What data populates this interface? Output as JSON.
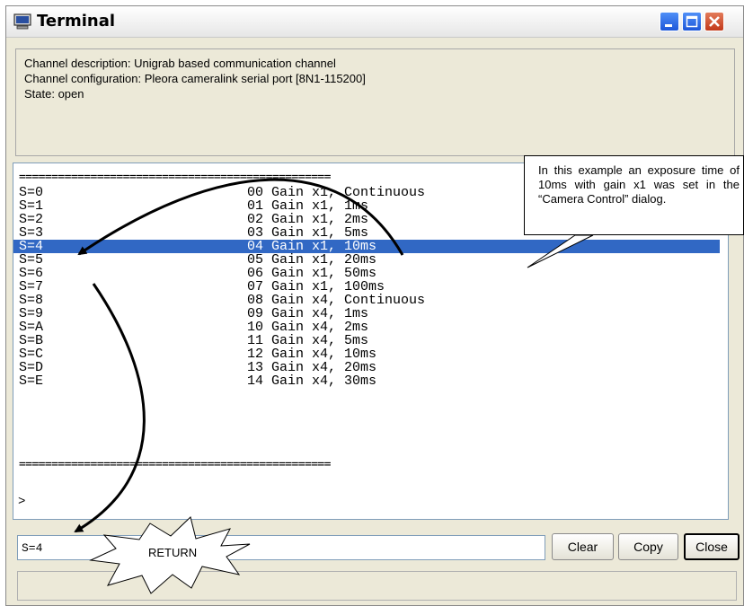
{
  "window": {
    "title": "Terminal"
  },
  "info": {
    "description": "Channel description: Unigrab based communication channel",
    "configuration": "Channel configuration: Pleora cameralink serial port [8N1-115200]",
    "state": "State: open"
  },
  "terminal": {
    "separator": "================================================",
    "rows": [
      {
        "cmd": "S=0",
        "desc": "00 Gain x1, Continuous"
      },
      {
        "cmd": "S=1",
        "desc": "01 Gain x1, 1ms"
      },
      {
        "cmd": "S=2",
        "desc": "02 Gain x1, 2ms"
      },
      {
        "cmd": "S=3",
        "desc": "03 Gain x1, 5ms"
      },
      {
        "cmd": "S=4",
        "desc": "04 Gain x1, 10ms"
      },
      {
        "cmd": "S=5",
        "desc": "05 Gain x1, 20ms"
      },
      {
        "cmd": "S=6",
        "desc": "06 Gain x1, 50ms"
      },
      {
        "cmd": "S=7",
        "desc": "07 Gain x1, 100ms"
      },
      {
        "cmd": "S=8",
        "desc": "08 Gain x4, Continuous"
      },
      {
        "cmd": "S=9",
        "desc": "09 Gain x4, 1ms"
      },
      {
        "cmd": "S=A",
        "desc": "10 Gain x4, 2ms"
      },
      {
        "cmd": "S=B",
        "desc": "11 Gain x4, 5ms"
      },
      {
        "cmd": "S=C",
        "desc": "12 Gain x4, 10ms"
      },
      {
        "cmd": "S=D",
        "desc": "13 Gain x4, 20ms"
      },
      {
        "cmd": "S=E",
        "desc": "14 Gain x4, 30ms"
      }
    ],
    "selected_index": 4,
    "prompt": ">"
  },
  "input": {
    "value": "S=4"
  },
  "buttons": {
    "clear": "Clear",
    "copy": "Copy",
    "close": "Close"
  },
  "annotation": {
    "callout": "In this example an exposure time of 10ms with gain x1 was set in the “Camera Control” dialog.",
    "return_label": "RETURN"
  },
  "colors": {
    "selection": "#3168c4",
    "titlebar_button": "#1d57d9",
    "close_button": "#c2391a"
  }
}
